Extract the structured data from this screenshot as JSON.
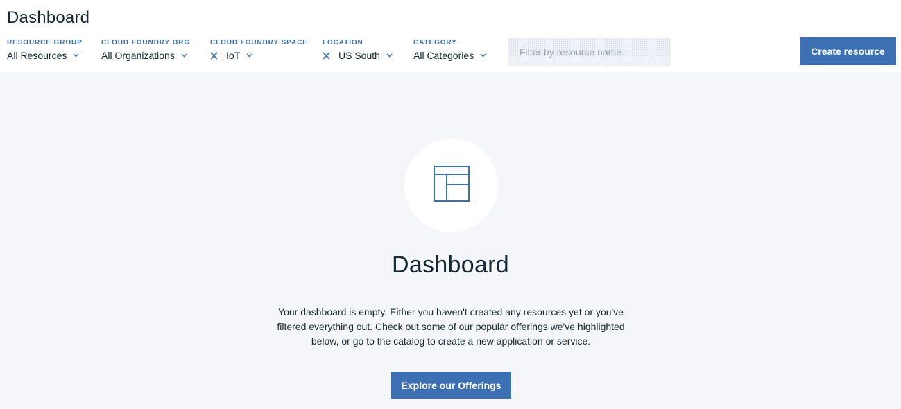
{
  "header": {
    "title": "Dashboard",
    "filters": [
      {
        "label": "RESOURCE GROUP",
        "value": "All Resources",
        "clearable": false
      },
      {
        "label": "CLOUD FOUNDRY ORG",
        "value": "All Organizations",
        "clearable": false
      },
      {
        "label": "CLOUD FOUNDRY SPACE",
        "value": "IoT",
        "clearable": true
      },
      {
        "label": "LOCATION",
        "value": "US South",
        "clearable": true
      },
      {
        "label": "CATEGORY",
        "value": "All Categories",
        "clearable": false
      }
    ],
    "search": {
      "placeholder": "Filter by resource name...",
      "value": ""
    },
    "create_button_label": "Create resource"
  },
  "empty_state": {
    "icon": "dashboard-layout-icon",
    "title": "Dashboard",
    "description": "Your dashboard is empty. Either you haven't created any resources yet or you've filtered everything out. Check out some of our popular offerings we've highlighted below, or go to the catalog to create a new application or service.",
    "button_label": "Explore our Offerings"
  },
  "colors": {
    "accent": "#3d70b2",
    "text": "#152935",
    "main_background": "#f4f6f9",
    "input_background": "#eef1f6"
  }
}
